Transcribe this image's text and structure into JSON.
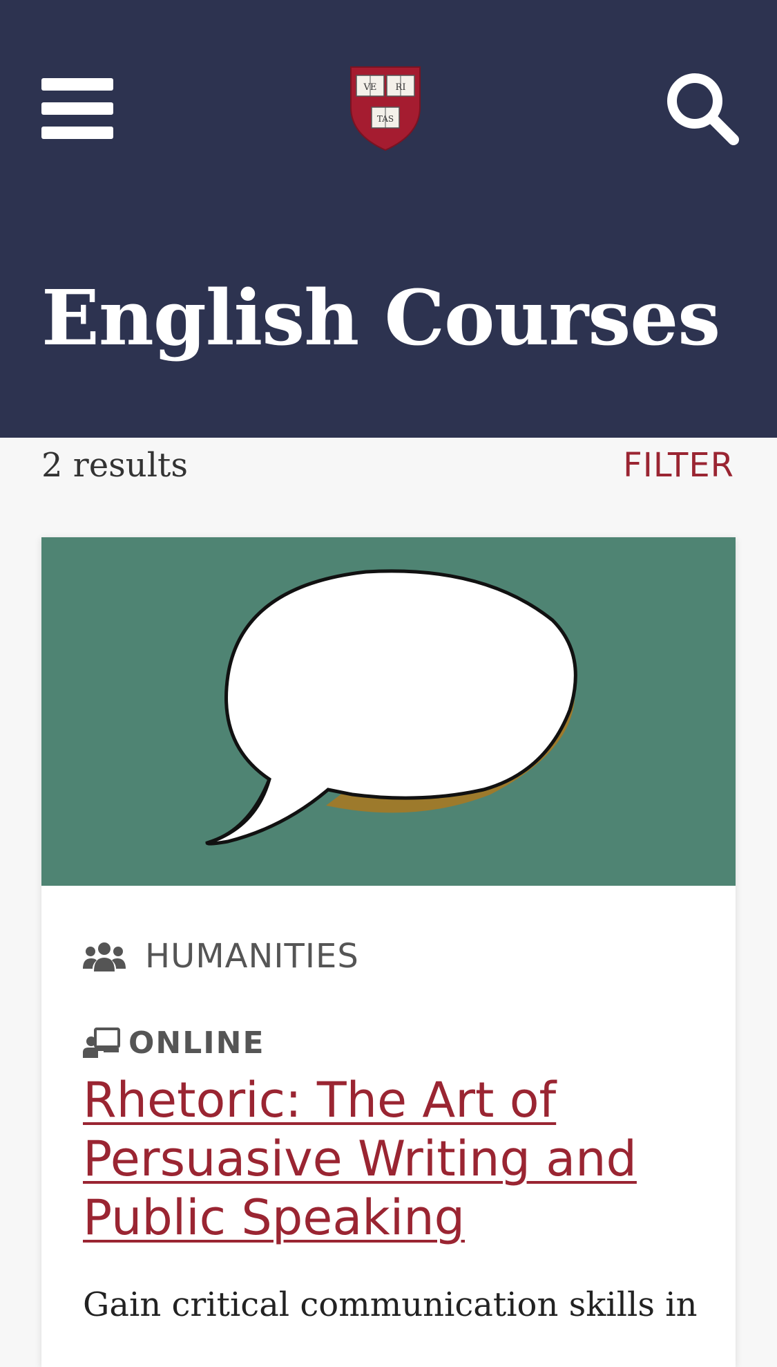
{
  "header": {
    "menu_icon": "hamburger-menu-icon",
    "logo_icon": "veritas-shield-logo",
    "logo_text": [
      "VE",
      "RI",
      "TAS"
    ],
    "search_icon": "search-icon",
    "title": "English Courses",
    "background_color": "#2d3350"
  },
  "results": {
    "count_text": "2 results",
    "filter_label": "FILTER"
  },
  "course_card": {
    "image_icon": "speech-bubble-illustration",
    "category_icon": "people-group-icon",
    "category": "HUMANITIES",
    "format_icon": "online-teaching-icon",
    "format": "ONLINE",
    "title": "Rhetoric: The Art of Persuasive Writing and Public Speaking",
    "description": "Gain critical communication skills in"
  },
  "colors": {
    "accent": "#9a2532",
    "header_bg": "#2d3350",
    "card_image_bg": "#4f8473",
    "page_bg": "#f7f7f7"
  }
}
